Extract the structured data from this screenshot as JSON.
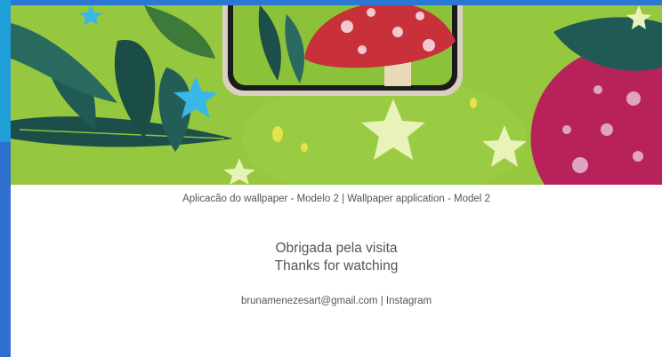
{
  "artwork": {
    "icons": [
      "wallpaper-artwork",
      "phone-mockup-icon",
      "mushroom-icon",
      "star-icon",
      "leaf-icon"
    ],
    "colors": {
      "grass": "#8cc23a",
      "grass_light": "#a6d24a",
      "leaf_dark": "#1d4f4a",
      "mushroom_red": "#c8303a",
      "mushroom_magenta": "#b8225a",
      "star": "#e9f2b8",
      "star_blue": "#39b7e6"
    }
  },
  "caption": {
    "text": "Aplicacão do wallpaper - Modelo 2 | Wallpaper application - Model 2"
  },
  "thanks": {
    "line_pt": "Obrigada pela visita",
    "line_en": "Thanks for watching"
  },
  "contact": {
    "email": "brunamenezesart@gmail.com",
    "separator": " | ",
    "instagram": "Instagram"
  },
  "theme": {
    "rail_blue": "#2f6fcf",
    "text_gray": "#555555"
  }
}
